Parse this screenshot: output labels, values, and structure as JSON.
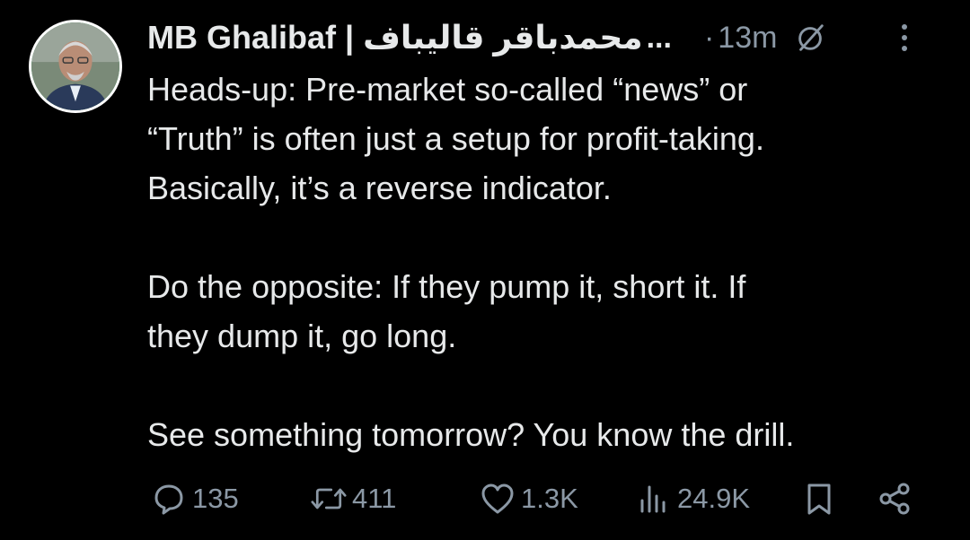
{
  "tweet": {
    "display_name": "MB Ghalibaf | محمدباقر قالیباف",
    "name_ellipsis": "...",
    "dot": "·",
    "timestamp": "13m",
    "text": "Heads-up: Pre-market so-called “news” or\n“Truth” is often just a setup for profit-taking.\nBasically, it’s a reverse indicator.\n\nDo the opposite: If they pump it, short it. If\nthey dump it, go long.\n\nSee something tomorrow? You know the drill."
  },
  "actions": {
    "reply_count": "135",
    "retweet_count": "411",
    "like_count": "1.3K",
    "view_count": "24.9K"
  },
  "icons": {
    "avatar": "profile-photo",
    "grok": "slashed-circle-icon",
    "more": "more-vertical-icon",
    "reply": "reply-icon",
    "retweet": "retweet-icon",
    "like": "heart-icon",
    "views": "views-chart-icon",
    "bookmark": "bookmark-icon",
    "share": "share-icon"
  },
  "colors": {
    "background": "#000000",
    "text": "#e7e9ea",
    "muted": "#8b98a5",
    "avatar_ring": "#16a34a"
  }
}
